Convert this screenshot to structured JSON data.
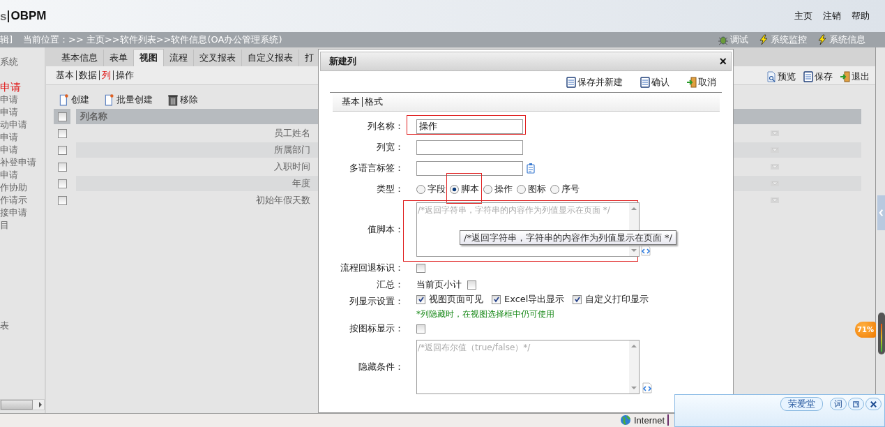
{
  "header": {
    "logo": "s",
    "brand": "OBPM",
    "links": [
      "主页",
      "注销",
      "帮助"
    ]
  },
  "location_bar": {
    "edit_fragment": "辑]",
    "breadcrumb": "当前位置：>> 主页>>软件列表>>软件信息(OA办公管理系统)",
    "actions": [
      {
        "label": "调试",
        "kind": "bug"
      },
      {
        "label": "系统监控",
        "kind": "bolt"
      },
      {
        "label": "系统信息",
        "kind": "bolt"
      }
    ]
  },
  "sidebar": {
    "sections": [
      {
        "title": "系统",
        "items": [
          {
            "label": "申请",
            "selected": true
          },
          {
            "label": "申请",
            "selected": false
          },
          {
            "label": "申请",
            "selected": false
          },
          {
            "label": "动申请",
            "selected": false
          },
          {
            "label": "申请",
            "selected": false
          },
          {
            "label": "申请",
            "selected": false
          },
          {
            "label": "补登申请",
            "selected": false
          },
          {
            "label": "申请",
            "selected": false
          },
          {
            "label": "作协助",
            "selected": false
          },
          {
            "label": "作请示",
            "selected": false
          },
          {
            "label": "接申请",
            "selected": false
          },
          {
            "label": "目",
            "selected": false
          }
        ]
      },
      {
        "title": "表"
      }
    ]
  },
  "tabs": [
    {
      "label": "基本信息",
      "selected": false
    },
    {
      "label": "表单",
      "selected": false
    },
    {
      "label": "视图",
      "selected": true
    },
    {
      "label": "流程",
      "selected": false
    },
    {
      "label": "交叉报表",
      "selected": false
    },
    {
      "label": "自定义报表",
      "selected": false
    },
    {
      "label": "打",
      "selected": false
    }
  ],
  "subtabs": [
    {
      "label": "基本",
      "selected": false
    },
    {
      "label": "数据",
      "selected": false
    },
    {
      "label": "列",
      "selected": true
    },
    {
      "label": "操作",
      "selected": false
    }
  ],
  "page_actions": [
    {
      "label": "预览",
      "kind": "preview"
    },
    {
      "label": "保存",
      "kind": "save"
    },
    {
      "label": "退出",
      "kind": "exit"
    }
  ],
  "toolbar": [
    {
      "label": "创建",
      "kind": "new"
    },
    {
      "label": "批量创建",
      "kind": "new"
    },
    {
      "label": "移除",
      "kind": "trash"
    }
  ],
  "table": {
    "columns": [
      "列名称"
    ],
    "all_checked": false,
    "rows": [
      {
        "name": "员工姓名",
        "checked": false
      },
      {
        "name": "所属部门",
        "checked": false
      },
      {
        "name": "入职时间",
        "checked": false
      },
      {
        "name": "年度",
        "checked": false
      },
      {
        "name": "初始年假天数",
        "checked": false
      }
    ]
  },
  "dialog": {
    "title": "新建列",
    "close": "×",
    "actions": [
      {
        "label": "保存并新建",
        "kind": "save"
      },
      {
        "label": "确认",
        "kind": "save"
      },
      {
        "label": "取消",
        "kind": "exit"
      }
    ],
    "tabs": [
      "基本",
      "格式"
    ],
    "fields": [
      {
        "kind": "text",
        "label": "列名称：",
        "value": "操作",
        "highlighted": true
      },
      {
        "kind": "text",
        "label": "列宽："
      },
      {
        "kind": "text_lang",
        "label": "多语言标签："
      },
      {
        "kind": "radio",
        "label": "类型：",
        "options": [
          {
            "label": "字段",
            "selected": false
          },
          {
            "label": "脚本",
            "selected": true,
            "highlighted": true
          },
          {
            "label": "操作",
            "selected": false
          },
          {
            "label": "图标",
            "selected": false
          },
          {
            "label": "序号",
            "selected": false
          }
        ]
      },
      {
        "kind": "textarea",
        "label": "值脚本：",
        "placeholder": "/*返回字符串，字符串的内容作为列值显示在页面 */",
        "highlighted": true
      },
      {
        "kind": "checkbox",
        "label": "流程回退标识：",
        "checked": false
      },
      {
        "kind": "labeled_check",
        "label": "汇总：",
        "text": "当前页小计",
        "checked": false
      },
      {
        "kind": "checklist",
        "label": "列显示设置：",
        "options": [
          {
            "label": "视图页面可见",
            "checked": true
          },
          {
            "label": "Excel导出显示",
            "checked": true
          },
          {
            "label": "自定义打印显示",
            "checked": true
          }
        ],
        "note": "*列隐藏时，在视图选择框中仍可使用"
      },
      {
        "kind": "checkbox",
        "label": "按图标显示：",
        "checked": false
      },
      {
        "kind": "textarea",
        "label": "隐藏条件：",
        "placeholder": "/*返回布尔值（true/false）*/"
      }
    ]
  },
  "tooltip": "/*返回字符串，字符串的内容作为列值显示在页面 */",
  "zoom_badge": "71%",
  "ime": {
    "candidate": "荣爱堂",
    "buttons": [
      "词"
    ]
  },
  "status_bar": {
    "zone": "Internet"
  }
}
